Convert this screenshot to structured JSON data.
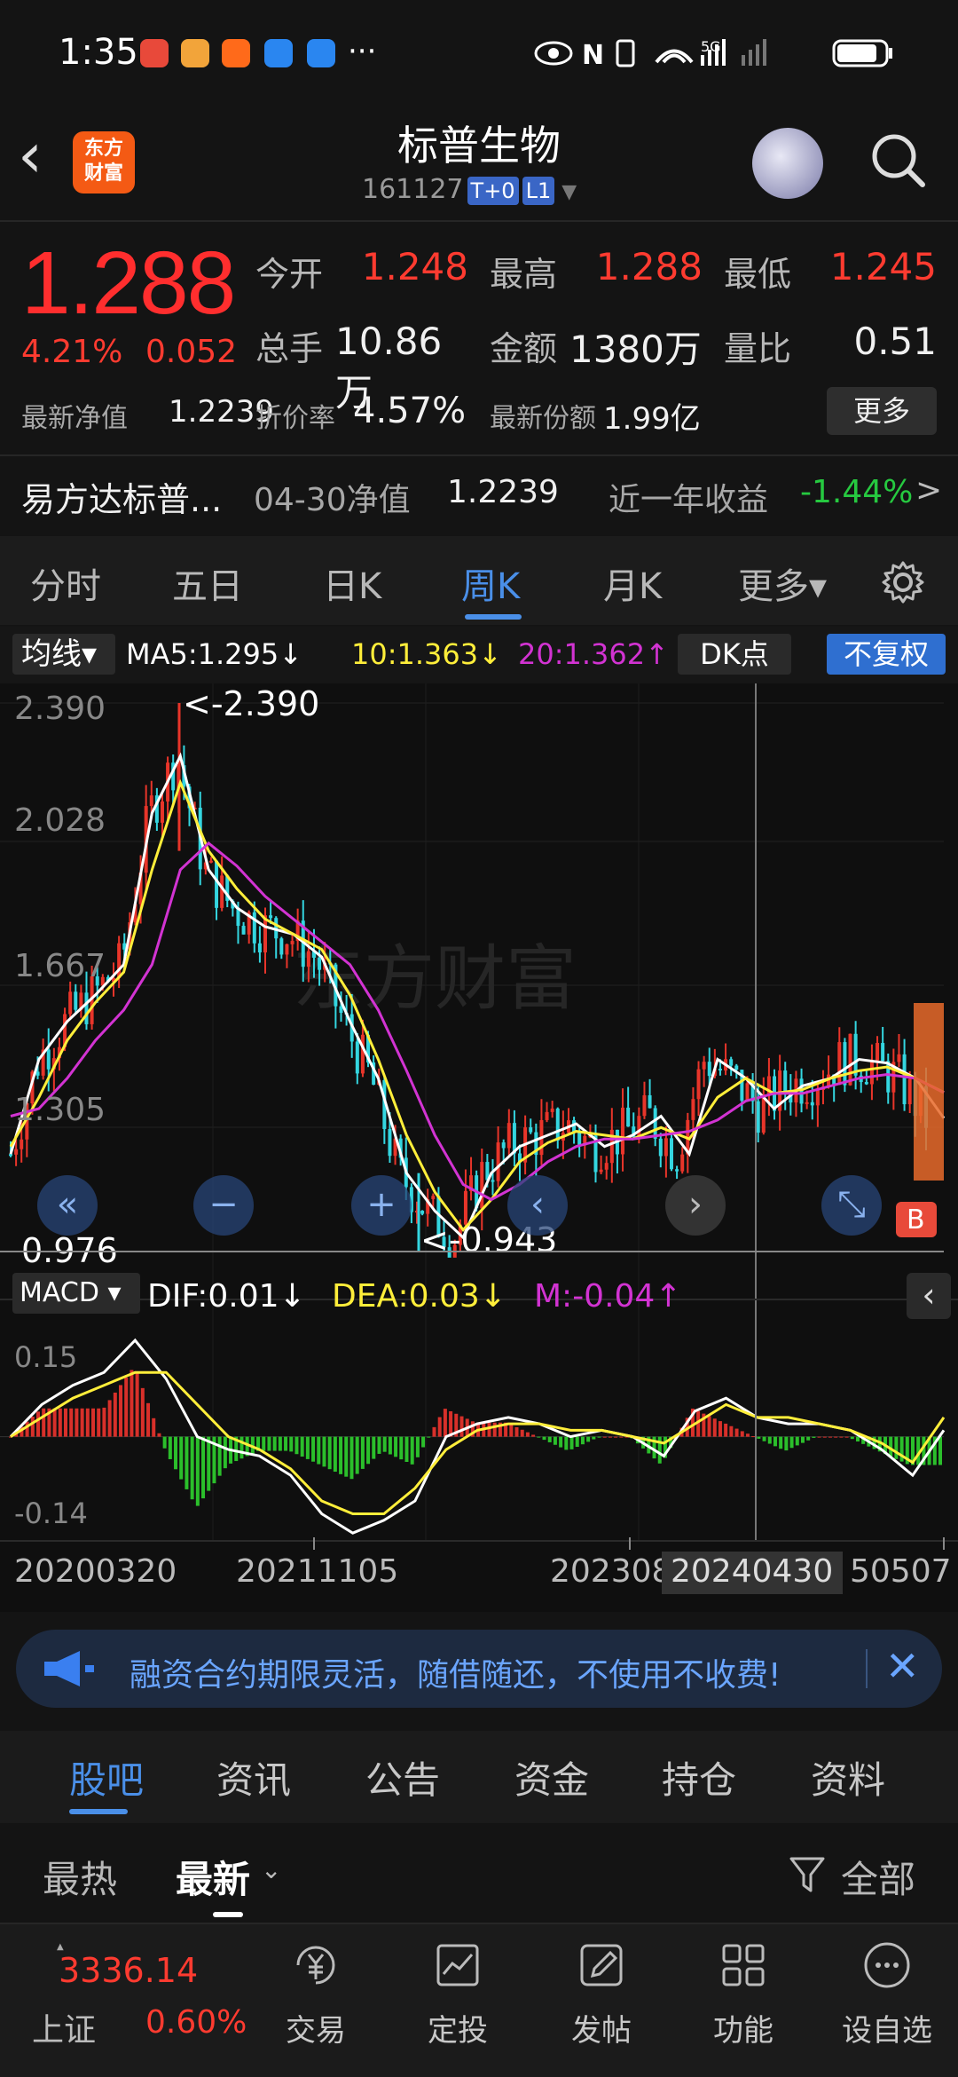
{
  "status_bar": {
    "time": "1:35",
    "dots": "···"
  },
  "header": {
    "title": "标普生物",
    "code": "161127",
    "tag1": "T+0",
    "tag2": "L1",
    "logo_text": "东方\n财富"
  },
  "quote": {
    "price": "1.288",
    "change_pct": "4.21%",
    "change_abs": "0.052",
    "open_label": "今开",
    "open": "1.248",
    "high_label": "最高",
    "high": "1.288",
    "low_label": "最低",
    "low": "1.245",
    "volume_label": "总手",
    "volume": "10.86万",
    "amount_label": "金额",
    "amount": "1380万",
    "vol_ratio_label": "量比",
    "vol_ratio": "0.51",
    "nav_label": "最新净值",
    "nav": "1.2239",
    "discount_label": "折价率",
    "discount": "4.57%",
    "shares_label": "最新份额",
    "shares": "1.99亿",
    "more_button": "更多"
  },
  "fund": {
    "name": "易方达标普...",
    "nav_label": "04-30净值",
    "nav": "1.2239",
    "return_label": "近一年收益",
    "return": "-1.44%",
    "arrow": ">"
  },
  "tabs": [
    "分时",
    "五日",
    "日K",
    "周K",
    "月K",
    "更多▾"
  ],
  "ma_bar": {
    "select": "均线▾",
    "ma5": "MA5:1.295↓",
    "ma10": "10:1.363↓",
    "ma20": "20:1.362↑",
    "dk": "DK点",
    "fq": "不复权"
  },
  "chart_labels": {
    "y1": "2.390",
    "y2": "2.028",
    "y3": "1.667",
    "y4": "1.305",
    "current": "0.976",
    "max_marker": "<-2.390",
    "min_marker": "<-0.943",
    "macd_select": "MACD ▾",
    "dif": "DIF:0.01↓",
    "dea": "DEA:0.03↓",
    "m": "M:-0.04↑",
    "macd_top": "0.15",
    "macd_bottom": "-0.14",
    "date1": "20200320",
    "date2": "20211105",
    "date3": "202308",
    "date_cursor": "20240430",
    "date4": "50507",
    "watermark": "东方财富",
    "side_B": "B"
  },
  "banner": {
    "text": "融资合约期限灵活，随借随还，不使用不收费!",
    "close": "✕"
  },
  "bottom_tabs": [
    "股吧",
    "资讯",
    "公告",
    "资金",
    "持仓",
    "资料"
  ],
  "sort_bar": {
    "hot": "最热",
    "latest": "最新",
    "filter": "全部"
  },
  "bottom_nav": {
    "index_value": "3336.14",
    "index_name": "上证",
    "index_pct": "0.60%",
    "items": [
      "交易",
      "定投",
      "发帖",
      "功能",
      "设自选"
    ]
  },
  "colors": {
    "up": "#ff3b30",
    "down": "#26c940",
    "accent": "#4a8fe8",
    "ma5": "#ffffff",
    "ma10": "#ffee3a",
    "ma20": "#d233d2",
    "cyan": "#34d6e0"
  },
  "chart_data": {
    "type": "candlestick",
    "ma_series": [
      {
        "name": "MA5",
        "values": [
          1.2,
          1.45,
          1.55,
          1.62,
          1.7,
          2.1,
          2.25,
          1.95,
          1.85,
          1.8,
          1.78,
          1.72,
          1.55,
          1.4,
          1.15,
          1.05,
          0.98,
          1.15,
          1.22,
          1.25,
          1.28,
          1.22,
          1.25,
          1.3,
          1.2,
          1.45,
          1.4,
          1.32,
          1.38,
          1.4,
          1.45,
          1.44,
          1.4,
          1.295
        ]
      },
      {
        "name": "10",
        "values": [
          1.22,
          1.35,
          1.5,
          1.6,
          1.68,
          1.95,
          2.18,
          2.0,
          1.9,
          1.82,
          1.78,
          1.74,
          1.62,
          1.45,
          1.25,
          1.1,
          1.0,
          1.08,
          1.18,
          1.23,
          1.26,
          1.25,
          1.24,
          1.27,
          1.24,
          1.35,
          1.4,
          1.36,
          1.37,
          1.4,
          1.42,
          1.43,
          1.4,
          1.363
        ]
      },
      {
        "name": "20",
        "values": [
          1.3,
          1.32,
          1.4,
          1.5,
          1.58,
          1.7,
          1.95,
          2.02,
          1.96,
          1.88,
          1.82,
          1.76,
          1.7,
          1.58,
          1.42,
          1.25,
          1.12,
          1.08,
          1.12,
          1.18,
          1.22,
          1.24,
          1.24,
          1.25,
          1.26,
          1.29,
          1.34,
          1.36,
          1.36,
          1.38,
          1.4,
          1.41,
          1.4,
          1.362
        ]
      }
    ],
    "macd": {
      "dif": [
        0.0,
        0.05,
        0.08,
        0.1,
        0.15,
        0.09,
        0.0,
        -0.02,
        -0.03,
        -0.06,
        -0.12,
        -0.15,
        -0.13,
        -0.1,
        0.0,
        0.02,
        0.03,
        0.02,
        0.0,
        0.01,
        0.0,
        -0.03,
        0.04,
        0.06,
        0.03,
        0.02,
        0.02,
        0.01,
        -0.02,
        -0.06,
        0.01
      ],
      "dea": [
        0.0,
        0.03,
        0.06,
        0.08,
        0.1,
        0.1,
        0.05,
        0.0,
        -0.02,
        -0.05,
        -0.1,
        -0.12,
        -0.12,
        -0.08,
        -0.02,
        0.01,
        0.02,
        0.02,
        0.01,
        0.01,
        0.0,
        -0.01,
        0.02,
        0.05,
        0.03,
        0.03,
        0.02,
        0.01,
        -0.01,
        -0.04,
        0.03
      ],
      "ylim": [
        -0.14,
        0.15
      ]
    },
    "ylim": [
      0.943,
      2.39
    ],
    "high_marker": 2.39,
    "low_marker": 0.943
  }
}
